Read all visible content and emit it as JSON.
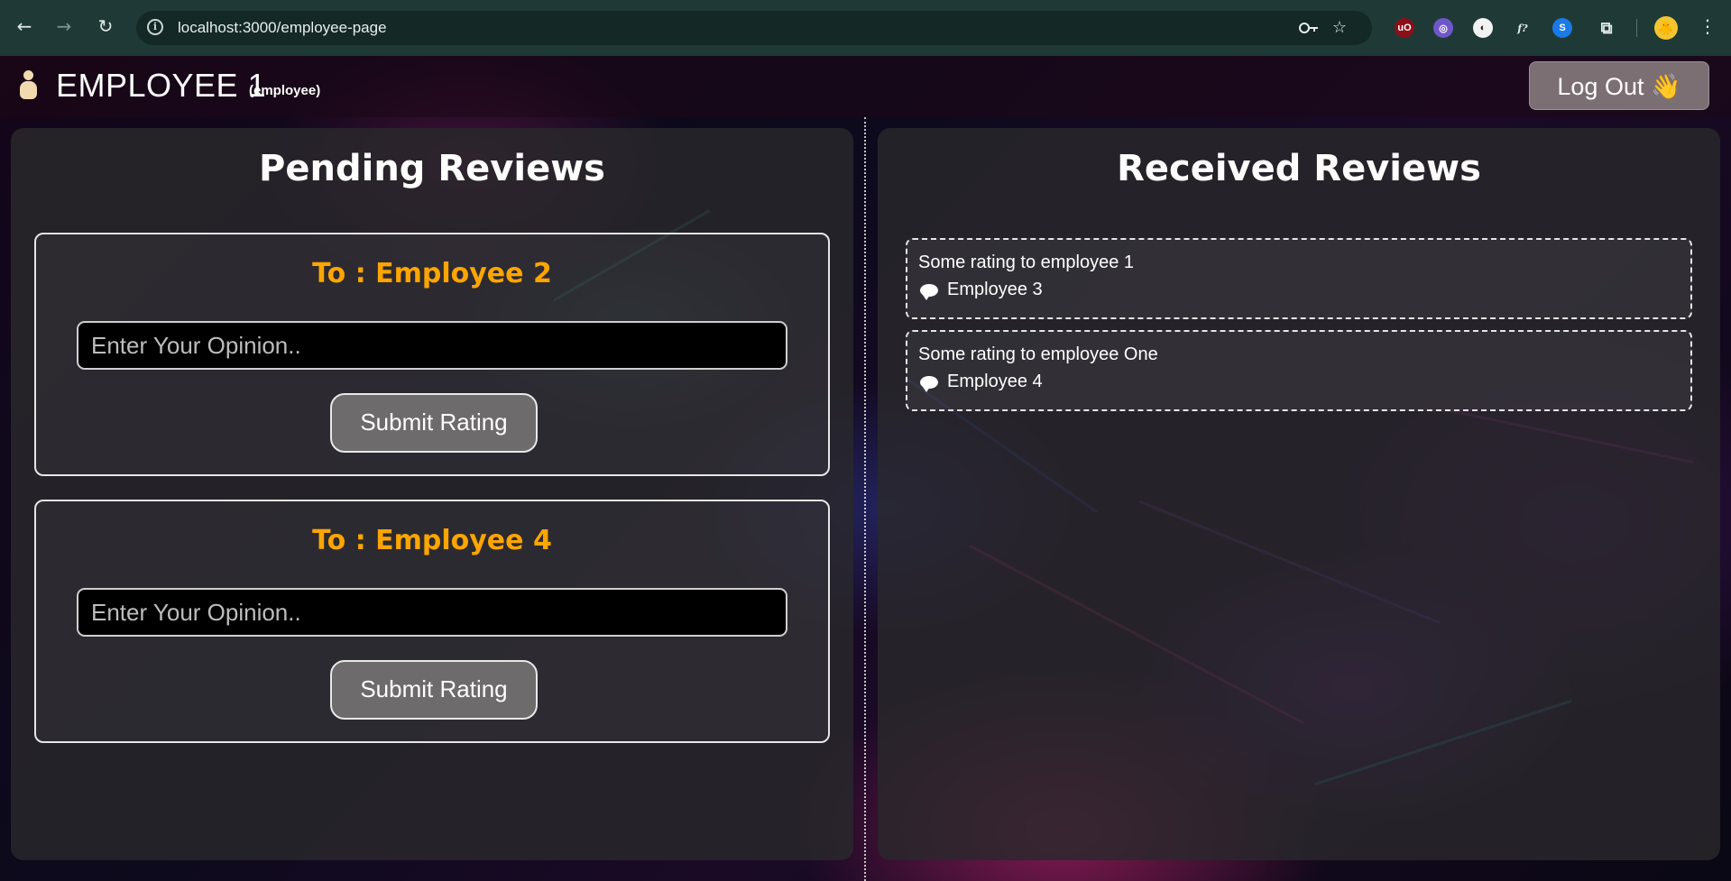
{
  "browser": {
    "url": "localhost:3000/employee-page",
    "nav": {
      "back_icon": "←",
      "forward_icon": "→",
      "reload_icon": "↻"
    },
    "icons": [
      "key-icon",
      "star-icon"
    ],
    "extensions": [
      {
        "name": "ublock-icon",
        "glyph": "uO",
        "color": "#8b0f18"
      },
      {
        "name": "extension-globe-icon",
        "glyph": "◎",
        "color": "#6f57c9"
      },
      {
        "name": "extension-circle-icon",
        "glyph": "◐",
        "color": "#f2f2f2"
      },
      {
        "name": "extension-fx-icon",
        "glyph": "f?",
        "color": "transparent"
      },
      {
        "name": "shazam-icon",
        "glyph": "S",
        "color": "#1b79e8"
      },
      {
        "name": "extensions-puzzle-icon",
        "glyph": "⧉",
        "color": "transparent"
      },
      {
        "name": "profile-avatar",
        "glyph": "🐥",
        "color": "#f4c430"
      }
    ],
    "menu_icon": "⋮"
  },
  "header": {
    "title": "EMPLOYEE 1",
    "role": "(employee)",
    "logout_label": "Log Out 👋"
  },
  "pending": {
    "title": "Pending Reviews",
    "items": [
      {
        "to_label": "To : Employee 2",
        "placeholder": "Enter Your Opinion..",
        "value": "",
        "submit_label": "Submit Rating"
      },
      {
        "to_label": "To : Employee 4",
        "placeholder": "Enter Your Opinion..",
        "value": "",
        "submit_label": "Submit Rating"
      }
    ]
  },
  "received": {
    "title": "Received Reviews",
    "items": [
      {
        "text": "Some rating to employee 1",
        "author": "Employee 3"
      },
      {
        "text": "Some rating to employee One",
        "author": "Employee 4"
      }
    ]
  },
  "colors": {
    "accent_orange": "#ffa500",
    "chrome": "#1f3a36",
    "button": "#6d6b6c",
    "logout": "#7b6f74"
  }
}
